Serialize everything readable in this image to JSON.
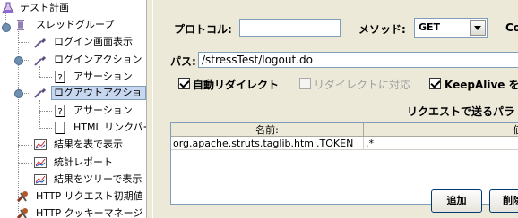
{
  "tree": {
    "items": [
      {
        "label": "テスト計画",
        "icon": "flask-icon"
      },
      {
        "label": "スレッドグループ",
        "icon": "spool-icon"
      },
      {
        "label": "ログイン画面表示",
        "icon": "pipette-icon"
      },
      {
        "label": "ログインアクション",
        "icon": "pipette-icon"
      },
      {
        "label": "アサーション",
        "icon": "question-doc-icon"
      },
      {
        "label": "ログアウトアクショ",
        "icon": "pipette-icon",
        "selected": true
      },
      {
        "label": "アサーション",
        "icon": "question-doc-icon"
      },
      {
        "label": "HTML リンクパー",
        "icon": "doc-icon"
      },
      {
        "label": "結果を表で表示",
        "icon": "chart-icon"
      },
      {
        "label": "統計レポート",
        "icon": "chart-icon"
      },
      {
        "label": "結果をツリーで表示",
        "icon": "chart-icon"
      },
      {
        "label": "HTTP リクエスト初期値",
        "icon": "tools-icon"
      },
      {
        "label": "HTTP クッキーマネージ",
        "icon": "tools-icon"
      }
    ]
  },
  "form": {
    "protocol_label": "プロトコル:",
    "protocol_value": "",
    "method_label": "メソッド:",
    "method_value": "GET",
    "cut_label": "Co",
    "path_label": "パス:",
    "path_value": "/stressTest/logout.do",
    "auto_redirect_label": "自動リダイレクト",
    "auto_redirect_checked": true,
    "follow_redirect_label": "リダイレクトに対応",
    "follow_redirect_checked": false,
    "keepalive_label": "KeepAlive を有",
    "keepalive_checked": true
  },
  "params": {
    "title": "リクエストで送るパラ",
    "columns": [
      "名前:",
      "値"
    ],
    "rows": [
      {
        "name": "org.apache.struts.taglib.html.TOKEN",
        "value": ".*"
      }
    ]
  },
  "buttons": {
    "add": "追加",
    "delete": "削除"
  }
}
